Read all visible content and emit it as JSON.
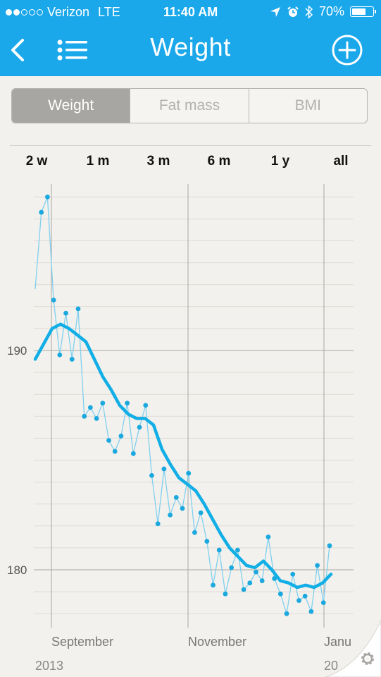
{
  "status_bar": {
    "carrier": "Verizon",
    "network": "LTE",
    "time": "11:40 AM",
    "battery": "70%",
    "battery_level": 0.7
  },
  "nav": {
    "title": "Weight",
    "back_icon": "chevron-left-icon",
    "list_icon": "list-icon",
    "add_icon": "plus-circle-icon"
  },
  "tabs": [
    "Weight",
    "Fat mass",
    "BMI"
  ],
  "active_tab": "Weight",
  "ranges": [
    "2 w",
    "1 m",
    "3 m",
    "6 m",
    "1 y",
    "all"
  ],
  "colors": {
    "accent": "#1ba8eb",
    "background": "#f3f1ed",
    "trend": "#12aee6",
    "measurements": "#1ba8de"
  },
  "chart_data": {
    "type": "line",
    "x_labels": [
      "September",
      "November",
      "Janu"
    ],
    "year_labels": [
      "2013",
      "20"
    ],
    "y_ticks": [
      180,
      190
    ],
    "ylim": [
      177.7,
      197.8
    ],
    "grid": true,
    "series": [
      {
        "style": "points",
        "values": [
          192.8,
          196.3,
          197.0,
          192.3,
          189.8,
          191.7,
          189.6,
          191.9,
          187.0,
          187.4,
          186.9,
          187.6,
          185.9,
          185.4,
          186.1,
          187.6,
          185.3,
          186.5,
          187.5,
          184.3,
          182.1,
          184.6,
          182.5,
          183.3,
          182.8,
          184.4,
          181.7,
          182.6,
          181.3,
          179.3,
          180.9,
          178.9,
          180.1,
          180.9,
          179.1,
          179.4,
          179.9,
          179.5,
          181.5,
          179.6,
          178.9,
          178.0,
          179.8,
          178.6,
          178.8,
          178.1,
          180.2,
          178.5,
          181.1
        ]
      },
      {
        "style": "trend",
        "values": [
          189.6,
          190.3,
          191.0,
          191.2,
          191.0,
          190.7,
          190.4,
          189.6,
          188.8,
          188.2,
          187.5,
          187.1,
          186.9,
          186.9,
          186.6,
          185.5,
          184.8,
          184.2,
          183.9,
          183.6,
          183.0,
          182.3,
          181.6,
          181.0,
          180.6,
          180.2,
          180.1,
          180.4,
          180.0,
          179.5,
          179.4,
          179.2,
          179.3,
          179.2,
          179.4,
          179.8
        ]
      }
    ]
  }
}
